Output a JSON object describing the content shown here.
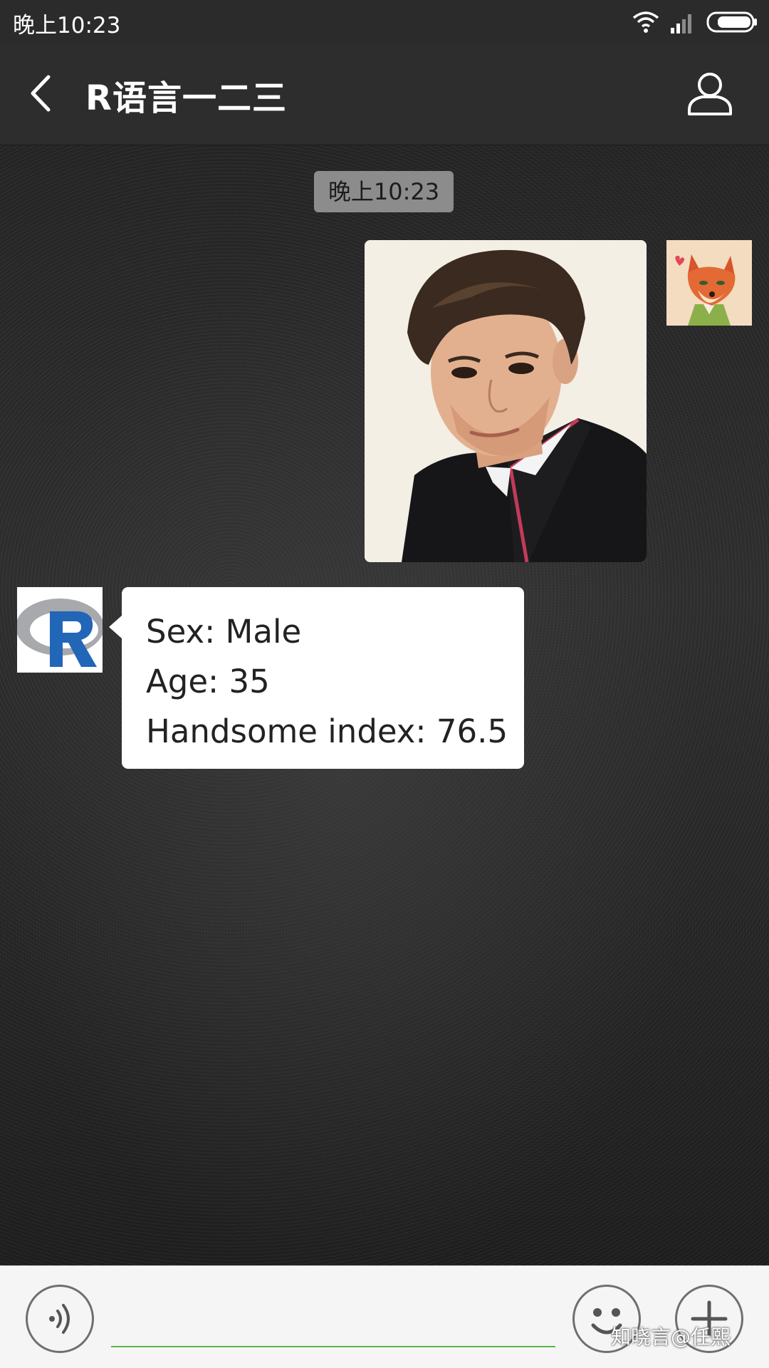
{
  "status_bar": {
    "time": "晚上10:23",
    "icons": [
      "wifi-icon",
      "signal-icon",
      "battery-icon"
    ]
  },
  "header": {
    "title": "R语言一二三",
    "icons": [
      "back-arrow-icon",
      "person-icon"
    ]
  },
  "chat": {
    "timestamp": "晚上10:23",
    "messages": [
      {
        "from": "me",
        "type": "image",
        "content": "portrait-photo"
      },
      {
        "from": "bot",
        "type": "text",
        "lines": [
          "Sex: Male",
          "Age: 35",
          "Handsome index: 76.5"
        ]
      }
    ]
  },
  "input_bar": {
    "placeholder": "",
    "icons": [
      "voice-icon",
      "emoji-icon",
      "plus-icon"
    ],
    "accent_color": "#59b64a"
  },
  "watermark": {
    "text": "知晓言@任熙"
  }
}
